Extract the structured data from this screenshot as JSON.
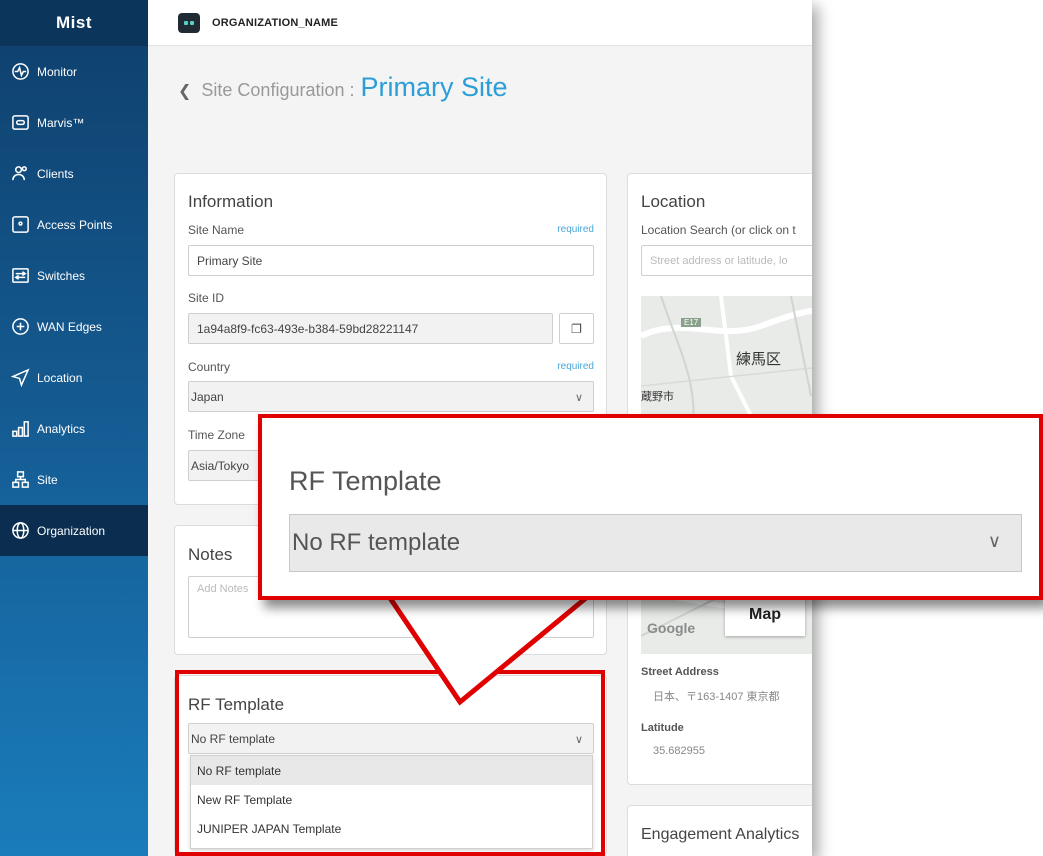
{
  "app": {
    "logo": "Mist",
    "org_name": "ORGANIZATION_NAME"
  },
  "sidebar": {
    "items": [
      {
        "label": "Monitor",
        "icon": "monitor-icon"
      },
      {
        "label": "Marvis™",
        "icon": "marvis-icon"
      },
      {
        "label": "Clients",
        "icon": "clients-icon"
      },
      {
        "label": "Access Points",
        "icon": "access-point-icon"
      },
      {
        "label": "Switches",
        "icon": "switch-icon"
      },
      {
        "label": "WAN Edges",
        "icon": "wan-edge-icon"
      },
      {
        "label": "Location",
        "icon": "location-icon"
      },
      {
        "label": "Analytics",
        "icon": "analytics-icon"
      },
      {
        "label": "Site",
        "icon": "site-icon"
      },
      {
        "label": "Organization",
        "icon": "organization-icon"
      }
    ],
    "active": "Organization"
  },
  "header": {
    "breadcrumb": "Site Configuration :",
    "site_name": "Primary Site"
  },
  "information": {
    "title": "Information",
    "site_name_label": "Site Name",
    "required": "required",
    "site_name_value": "Primary Site",
    "site_id_label": "Site ID",
    "site_id_value": "1a94a8f9-fc63-493e-b384-59bd28221147",
    "country_label": "Country",
    "country_value": "Japan",
    "timezone_label": "Time Zone",
    "timezone_value": "Asia/Tokyo"
  },
  "notes": {
    "title": "Notes",
    "placeholder": "Add Notes"
  },
  "rf_template": {
    "title": "RF Template",
    "selected": "No RF template",
    "options": [
      "No RF template",
      "New RF Template",
      "JUNIPER JAPAN Template"
    ]
  },
  "location": {
    "title": "Location",
    "search_label": "Location Search (or click on t",
    "search_placeholder": "Street address or latitude, lo",
    "map_labels": {
      "road": "E17",
      "district": "練馬区",
      "city": "蔵野市",
      "map_button": "Map",
      "google": "Google"
    },
    "street_address_label": "Street Address",
    "street_address_value": "日本、〒163-1407 東京都",
    "latitude_label": "Latitude",
    "latitude_value": "35.682955"
  },
  "engagement": {
    "title": "Engagement Analytics"
  },
  "callout": {
    "title": "RF Template",
    "value": "No RF template"
  },
  "colors": {
    "accent": "#2b9ed8",
    "highlight": "#e10000",
    "sidebar_top": "#0e3f6c",
    "sidebar_bottom": "#1a7cbb"
  }
}
